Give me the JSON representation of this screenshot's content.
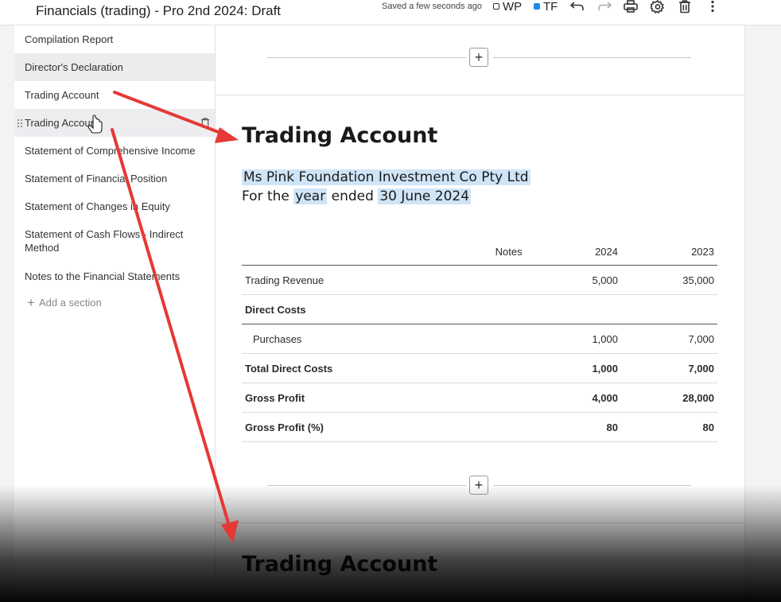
{
  "header": {
    "title": "Financials (trading) - Pro 2nd 2024: Draft",
    "saved_status": "Saved a few seconds ago",
    "toggle_wp": "WP",
    "toggle_tf": "TF",
    "icons": [
      "undo-icon",
      "redo-icon",
      "print-icon",
      "settings-icon",
      "trash-icon",
      "more-icon"
    ]
  },
  "sidebar": {
    "items": [
      {
        "label": "Compilation Report"
      },
      {
        "label": "Director's Declaration"
      },
      {
        "label": "Trading Account"
      },
      {
        "label": "Trading Account"
      },
      {
        "label": "Statement of Comprehensive Income"
      },
      {
        "label": "Statement of Financial Position"
      },
      {
        "label": "Statement of Changes in Equity"
      },
      {
        "label": "Statement of Cash Flows - Indirect Method"
      },
      {
        "label": "Notes to the Financial Statements"
      }
    ],
    "add_section": "Add a section"
  },
  "document": {
    "heading": "Trading Account",
    "entity_name": "Ms Pink Foundation Investment Co Pty Ltd",
    "period_for": "For the",
    "period_year": "year",
    "period_ended": "ended",
    "period_date": "30 June 2024",
    "add_button": "+",
    "next_heading": "Trading Account",
    "table": {
      "headers": [
        "",
        "Notes",
        "2024",
        "2023"
      ],
      "rows": [
        {
          "label": "Trading Revenue",
          "notes": "",
          "y2024": "5,000",
          "y2023": "35,000"
        },
        {
          "label": "Direct Costs",
          "notes": "",
          "y2024": "",
          "y2023": ""
        },
        {
          "label": "Purchases",
          "notes": "",
          "y2024": "1,000",
          "y2023": "7,000"
        },
        {
          "label": "Total Direct Costs",
          "notes": "",
          "y2024": "1,000",
          "y2023": "7,000"
        },
        {
          "label": "Gross Profit",
          "notes": "",
          "y2024": "4,000",
          "y2023": "28,000"
        },
        {
          "label": "Gross Profit (%)",
          "notes": "",
          "y2024": "80",
          "y2023": "80"
        }
      ]
    }
  },
  "colors": {
    "highlight": "#cfe4f7",
    "annotation_arrow": "#e53935",
    "toggle_on": "#1e88e5"
  }
}
